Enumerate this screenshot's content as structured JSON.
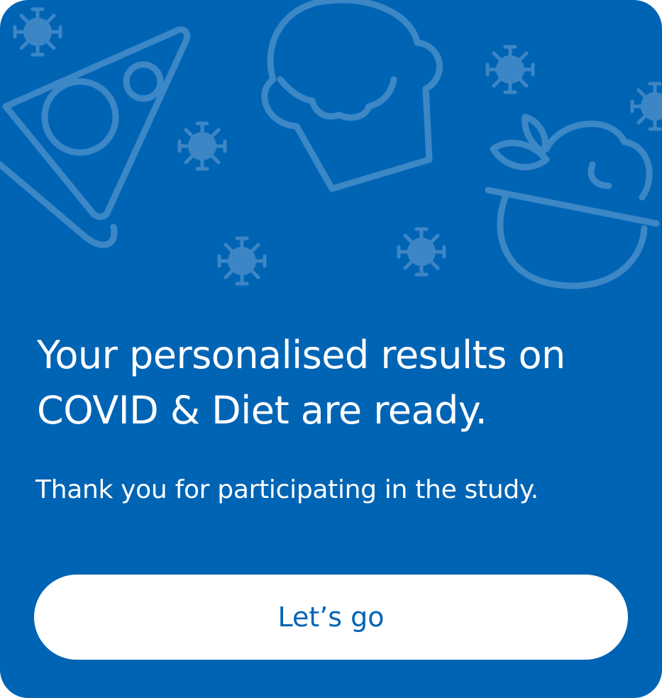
{
  "card": {
    "title": "Your personalised results on COVID & Diet are ready.",
    "subtitle": "Thank you for participating in the study.",
    "button_label": "Let’s go"
  },
  "illustration": {
    "icons": [
      "pizza-slice-icon",
      "cupcake-icon",
      "salad-bowl-icon",
      "virus-icon"
    ]
  },
  "colors": {
    "background": "#0064b5",
    "illustration_stroke": "#3c87c6",
    "virus_fill": "#3d86c6",
    "button_background": "#ffffff",
    "button_text": "#0064b5",
    "text": "#ffffff"
  }
}
